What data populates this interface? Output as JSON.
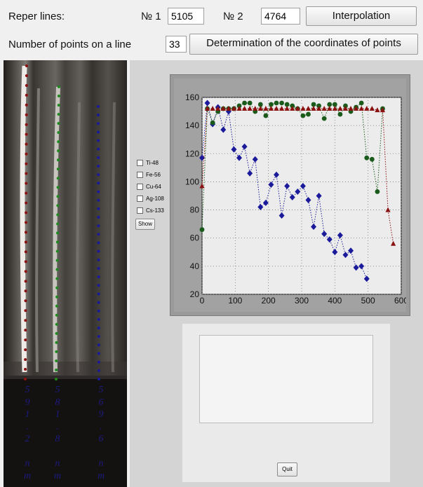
{
  "toolbar": {
    "reper_lines_label": "Reper lines:",
    "no1_label": "№ 1",
    "no1_value": "5105",
    "no2_label": "№ 2",
    "no2_value": "4764",
    "interpolation_label": "Interpolation",
    "points_label": "Number of points on a line",
    "points_value": "33",
    "determination_label": "Determination of the coordinates of points"
  },
  "spectrum": {
    "line_labels": [
      [
        "5",
        "9",
        "1",
        ".",
        "2",
        "",
        "n",
        "m"
      ],
      [
        "5",
        "8",
        "1",
        ".",
        "8",
        "",
        "n",
        "m"
      ],
      [
        "5",
        "6",
        "9",
        ".",
        "6",
        "",
        "n",
        "m"
      ]
    ],
    "line_colors": [
      "#8b1010",
      "#1f8a1f",
      "#1a1a9a"
    ]
  },
  "elements": [
    {
      "label": "Ti-48"
    },
    {
      "label": "Fe-56"
    },
    {
      "label": "Cu-64"
    },
    {
      "label": "Ag-108"
    },
    {
      "label": "Cs-133"
    }
  ],
  "show_label": "Show",
  "quit_label": "Quit",
  "chart_data": {
    "type": "scatter",
    "xlim": [
      0,
      600
    ],
    "ylim": [
      20,
      160
    ],
    "xticks": [
      0,
      100,
      200,
      300,
      400,
      500,
      600
    ],
    "yticks": [
      20,
      40,
      60,
      80,
      100,
      120,
      140,
      160
    ],
    "grid": true,
    "series": [
      {
        "color": "#1a1a9a",
        "marker": "diamond",
        "x": [
          0,
          16,
          32,
          48,
          64,
          80,
          96,
          112,
          128,
          144,
          160,
          176,
          192,
          208,
          224,
          240,
          256,
          272,
          288,
          304,
          320,
          336,
          352,
          368,
          384,
          400,
          416,
          432,
          448,
          464,
          480,
          496
        ],
        "y": [
          117,
          156,
          141,
          153,
          137,
          150,
          123,
          117,
          125,
          106,
          116,
          82,
          85,
          98,
          105,
          76,
          97,
          89,
          93,
          97,
          87,
          68,
          90,
          63,
          59,
          50,
          62,
          48,
          51,
          39,
          40,
          31
        ]
      },
      {
        "color": "#1a5a1a",
        "marker": "circle",
        "x": [
          0,
          16,
          32,
          48,
          64,
          80,
          96,
          112,
          128,
          144,
          160,
          176,
          192,
          208,
          224,
          240,
          256,
          272,
          288,
          304,
          320,
          336,
          352,
          368,
          384,
          400,
          416,
          432,
          448,
          464,
          480,
          496,
          512,
          528,
          544
        ],
        "y": [
          66,
          152,
          142,
          150,
          152,
          152,
          152,
          154,
          156,
          156,
          150,
          155,
          147,
          155,
          156,
          156,
          155,
          154,
          152,
          147,
          148,
          155,
          154,
          145,
          155,
          155,
          148,
          154,
          150,
          153,
          156,
          117,
          116,
          93,
          152
        ]
      },
      {
        "color": "#8b1010",
        "marker": "triangle",
        "x": [
          0,
          16,
          32,
          48,
          64,
          80,
          96,
          112,
          128,
          144,
          160,
          176,
          192,
          208,
          224,
          240,
          256,
          272,
          288,
          304,
          320,
          336,
          352,
          368,
          384,
          400,
          416,
          432,
          448,
          464,
          480,
          496,
          512,
          528,
          544,
          560,
          576
        ],
        "y": [
          97,
          152,
          152,
          152,
          152,
          152,
          152,
          152,
          152,
          152,
          152,
          152,
          152,
          152,
          152,
          152,
          152,
          152,
          152,
          152,
          152,
          152,
          152,
          152,
          152,
          152,
          152,
          152,
          152,
          152,
          152,
          152,
          152,
          151,
          151,
          80,
          56
        ]
      }
    ]
  }
}
